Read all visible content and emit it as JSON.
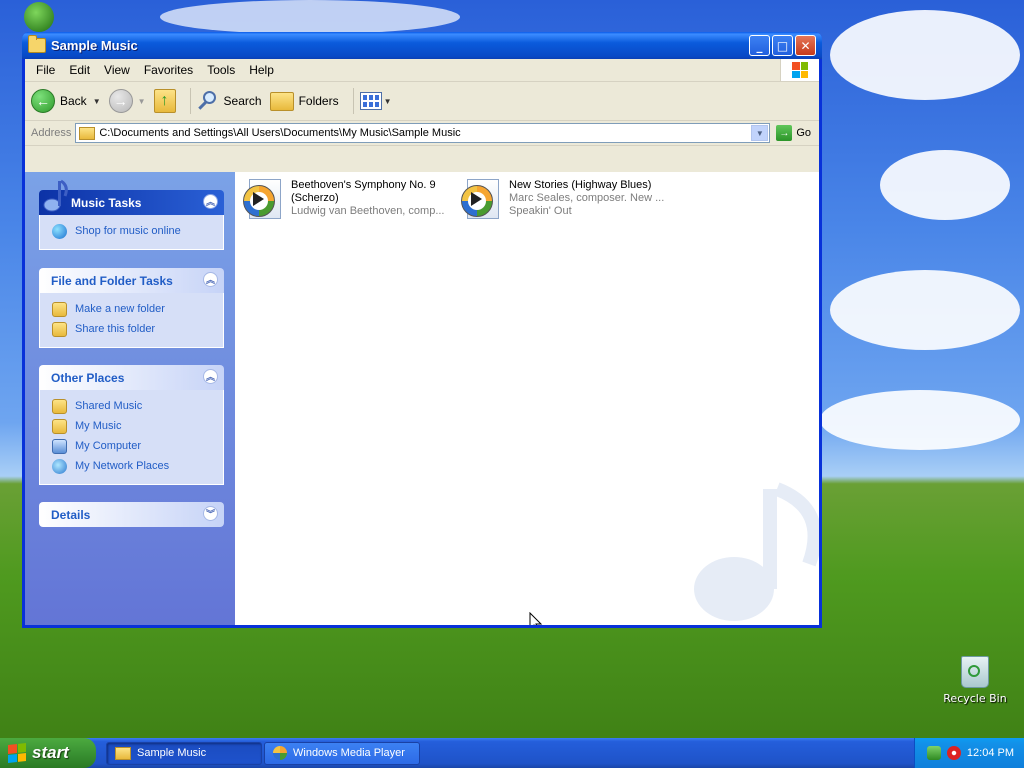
{
  "window": {
    "title": "Sample Music",
    "controls": {
      "minimize": "_",
      "maximize": "□",
      "close": "✕"
    }
  },
  "menubar": {
    "items": [
      "File",
      "Edit",
      "View",
      "Favorites",
      "Tools",
      "Help"
    ]
  },
  "toolbar": {
    "back_label": "Back",
    "search_label": "Search",
    "folders_label": "Folders"
  },
  "address": {
    "label": "Address",
    "value": "C:\\Documents and Settings\\All Users\\Documents\\My Music\\Sample Music",
    "go_label": "Go"
  },
  "leftpane": {
    "music_tasks": {
      "title": "Music Tasks",
      "items": [
        "Shop for music online"
      ]
    },
    "file_folder_tasks": {
      "title": "File and Folder Tasks",
      "items": [
        "Make a new folder",
        "Share this folder"
      ]
    },
    "other_places": {
      "title": "Other Places",
      "items": [
        "Shared Music",
        "My Music",
        "My Computer",
        "My Network Places"
      ]
    },
    "details": {
      "title": "Details"
    }
  },
  "files": [
    {
      "title_line1": "Beethoven's Symphony No. 9",
      "title_line2": "(Scherzo)",
      "sub1": "Ludwig van Beethoven, comp...",
      "sub2": ""
    },
    {
      "title_line1": "New Stories (Highway Blues)",
      "title_line2": "",
      "sub1": "Marc Seales, composer. New ...",
      "sub2": "Speakin' Out"
    }
  ],
  "desktop": {
    "recycle_bin": "Recycle Bin"
  },
  "taskbar": {
    "start": "start",
    "buttons": [
      "Sample Music",
      "Windows Media Player"
    ],
    "clock": "12:04 PM"
  }
}
